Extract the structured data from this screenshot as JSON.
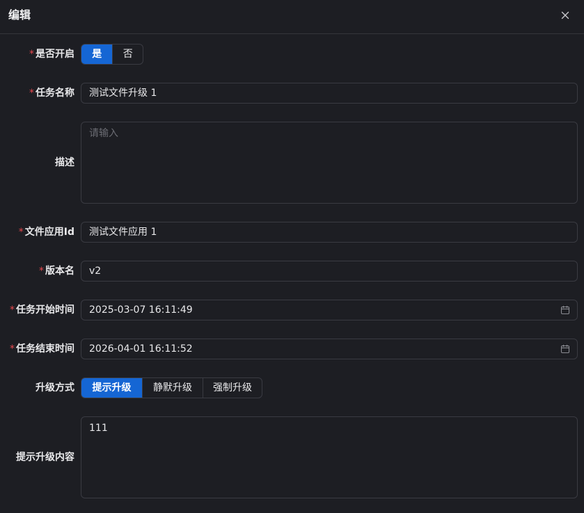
{
  "dialog": {
    "title": "编辑",
    "close_icon": "close-icon"
  },
  "required_mark": "*",
  "fields": {
    "enabled": {
      "label": "是否开启",
      "options": [
        "是",
        "否"
      ],
      "selected": "是"
    },
    "task_name": {
      "label": "任务名称",
      "value": "测试文件升级 1"
    },
    "description": {
      "label": "描述",
      "value": "",
      "placeholder": "请输入"
    },
    "file_app_id": {
      "label": "文件应用Id",
      "value": "测试文件应用 1"
    },
    "version_name": {
      "label": "版本名",
      "value": "v2"
    },
    "start_time": {
      "label": "任务开始时间",
      "value": "2025-03-07 16:11:49",
      "icon": "calendar-icon"
    },
    "end_time": {
      "label": "任务结束时间",
      "value": "2026-04-01 16:11:52",
      "icon": "calendar-icon"
    },
    "upgrade_mode": {
      "label": "升级方式",
      "options": [
        "提示升级",
        "静默升级",
        "强制升级"
      ],
      "selected": "提示升级"
    },
    "prompt_content": {
      "label": "提示升级内容",
      "value": "111"
    }
  },
  "colors": {
    "background": "#1d1e23",
    "accent": "#1566d4",
    "required": "#e5484d",
    "border": "#3a3b42"
  }
}
